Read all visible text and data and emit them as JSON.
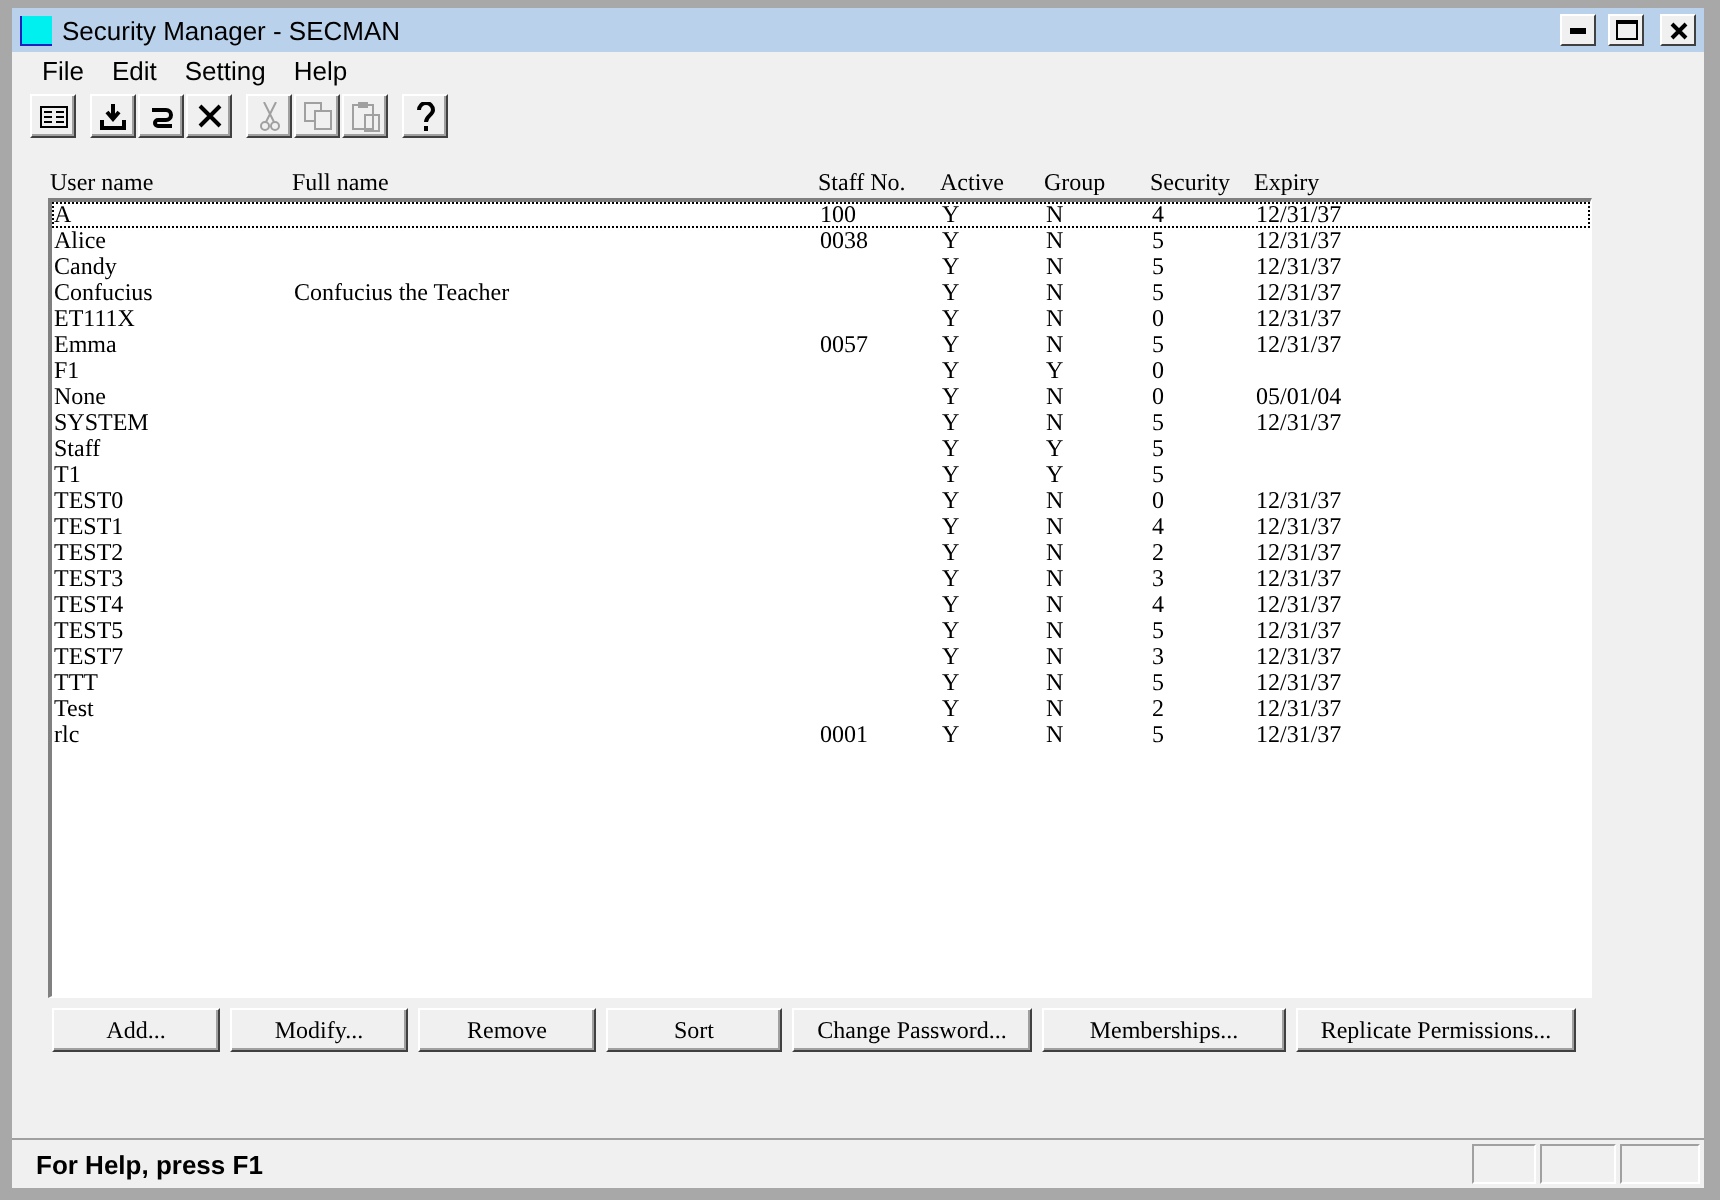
{
  "window": {
    "title": "Security Manager - SECMAN"
  },
  "menu": [
    "File",
    "Edit",
    "Setting",
    "Help"
  ],
  "toolbar": [
    [
      {
        "kind": "properties",
        "disabled": false
      }
    ],
    [
      {
        "kind": "import",
        "disabled": false
      },
      {
        "kind": "refresh",
        "disabled": false
      },
      {
        "kind": "delete",
        "disabled": false
      }
    ],
    [
      {
        "kind": "cut",
        "disabled": true
      },
      {
        "kind": "copy",
        "disabled": true
      },
      {
        "kind": "paste",
        "disabled": true
      }
    ],
    [
      {
        "kind": "help",
        "disabled": false
      }
    ]
  ],
  "table": {
    "columns": [
      "User name",
      "Full name",
      "Staff No.",
      "Active",
      "Group",
      "Security",
      "Expiry"
    ],
    "rows": [
      {
        "cells": [
          "A",
          "",
          "100",
          "Y",
          "N",
          "4",
          "12/31/37"
        ],
        "selected": true
      },
      {
        "cells": [
          "Alice",
          "",
          "0038",
          "Y",
          "N",
          "5",
          "12/31/37"
        ],
        "selected": false
      },
      {
        "cells": [
          "Candy",
          "",
          "",
          "Y",
          "N",
          "5",
          "12/31/37"
        ],
        "selected": false
      },
      {
        "cells": [
          "Confucius",
          "Confucius the Teacher",
          "",
          "Y",
          "N",
          "5",
          "12/31/37"
        ],
        "selected": false
      },
      {
        "cells": [
          "ET111X",
          "",
          "",
          "Y",
          "N",
          "0",
          "12/31/37"
        ],
        "selected": false
      },
      {
        "cells": [
          "Emma",
          "",
          "0057",
          "Y",
          "N",
          "5",
          "12/31/37"
        ],
        "selected": false
      },
      {
        "cells": [
          "F1",
          "",
          "",
          "Y",
          "Y",
          "0",
          ""
        ],
        "selected": false
      },
      {
        "cells": [
          "None",
          "",
          "",
          "Y",
          "N",
          "0",
          "05/01/04"
        ],
        "selected": false
      },
      {
        "cells": [
          "SYSTEM",
          "",
          "",
          "Y",
          "N",
          "5",
          "12/31/37"
        ],
        "selected": false
      },
      {
        "cells": [
          "Staff",
          "",
          "",
          "Y",
          "Y",
          "5",
          ""
        ],
        "selected": false
      },
      {
        "cells": [
          "T1",
          "",
          "",
          "Y",
          "Y",
          "5",
          ""
        ],
        "selected": false
      },
      {
        "cells": [
          "TEST0",
          "",
          "",
          "Y",
          "N",
          "0",
          "12/31/37"
        ],
        "selected": false
      },
      {
        "cells": [
          "TEST1",
          "",
          "",
          "Y",
          "N",
          "4",
          "12/31/37"
        ],
        "selected": false
      },
      {
        "cells": [
          "TEST2",
          "",
          "",
          "Y",
          "N",
          "2",
          "12/31/37"
        ],
        "selected": false
      },
      {
        "cells": [
          "TEST3",
          "",
          "",
          "Y",
          "N",
          "3",
          "12/31/37"
        ],
        "selected": false
      },
      {
        "cells": [
          "TEST4",
          "",
          "",
          "Y",
          "N",
          "4",
          "12/31/37"
        ],
        "selected": false
      },
      {
        "cells": [
          "TEST5",
          "",
          "",
          "Y",
          "N",
          "5",
          "12/31/37"
        ],
        "selected": false
      },
      {
        "cells": [
          "TEST7",
          "",
          "",
          "Y",
          "N",
          "3",
          "12/31/37"
        ],
        "selected": false
      },
      {
        "cells": [
          "TTT",
          "",
          "",
          "Y",
          "N",
          "5",
          "12/31/37"
        ],
        "selected": false
      },
      {
        "cells": [
          "Test",
          "",
          "",
          "Y",
          "N",
          "2",
          "12/31/37"
        ],
        "selected": false
      },
      {
        "cells": [
          "rlc",
          "",
          "0001",
          "Y",
          "N",
          "5",
          "12/31/37"
        ],
        "selected": false
      }
    ]
  },
  "buttons": [
    "Add...",
    "Modify...",
    "Remove",
    "Sort",
    "Change Password...",
    "Memberships...",
    "Replicate Permissions..."
  ],
  "status_bar": {
    "text": "For Help, press F1"
  }
}
